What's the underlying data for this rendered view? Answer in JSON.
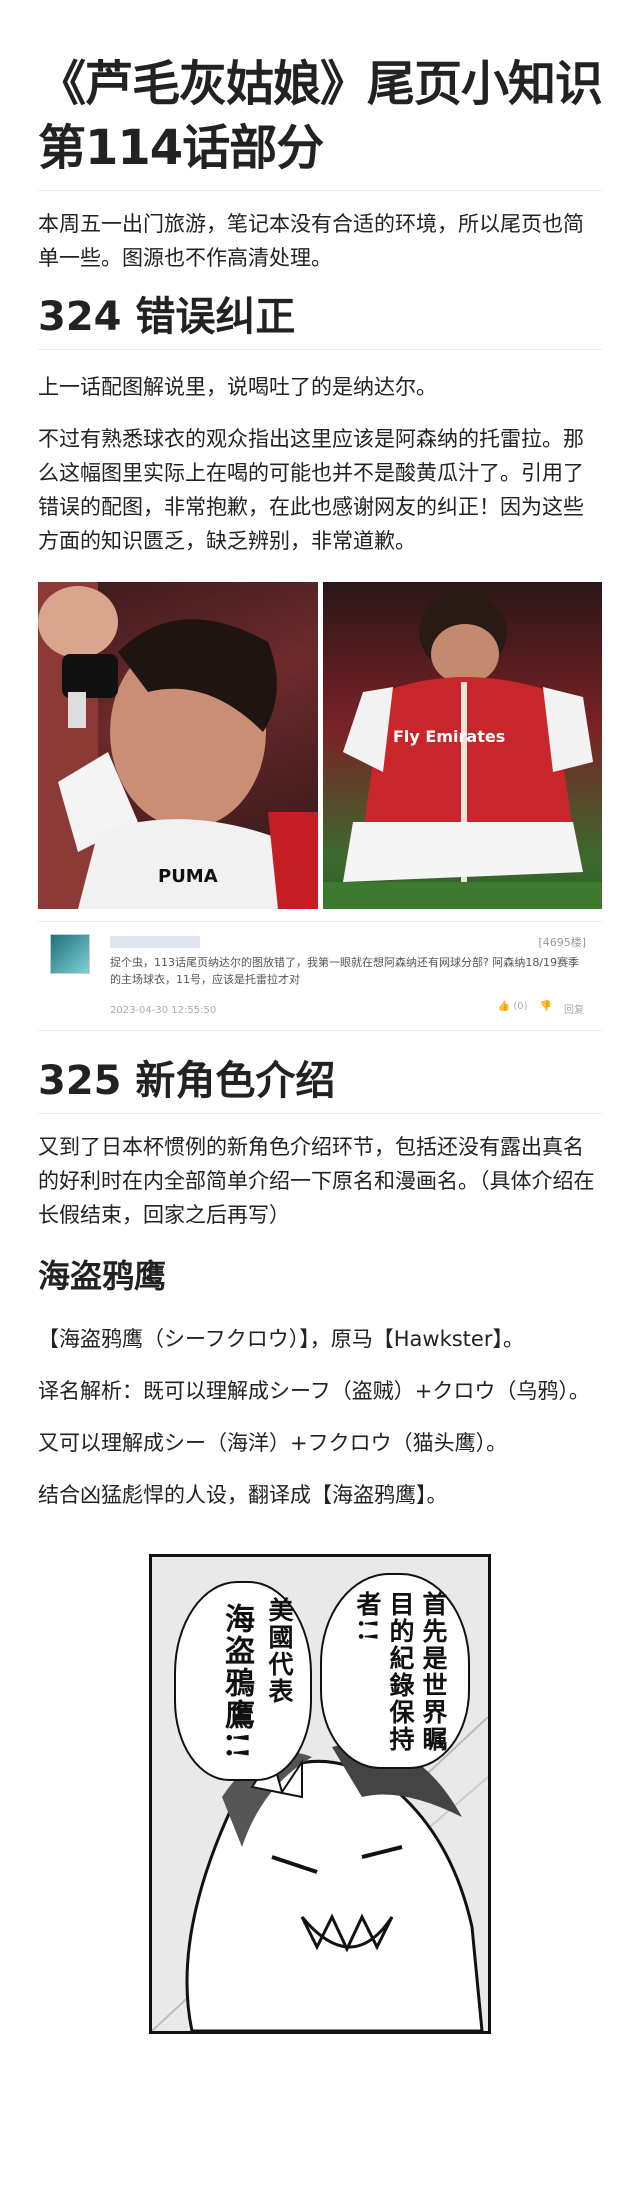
{
  "title": "《芦毛灰姑娘》尾页小知识 第114话部分",
  "intro": "本周五一出门旅游，笔记本没有合适的环境，所以尾页也简单一些。图源也不作高清处理。",
  "section324": {
    "heading": "324 错误纠正",
    "p1": "上一话配图解说里，说喝吐了的是纳达尔。",
    "p2": "不过有熟悉球衣的观众指出这里应该是阿森纳的托雷拉。那么这幅图里实际上在喝的可能也并不是酸黄瓜汁了。引用了错误的配图，非常抱歉，在此也感谢网友的纠正！因为这些方面的知识匮乏，缺乏辨别，非常道歉。"
  },
  "photos": {
    "left_jersey": "PUMA",
    "right_crest": "Fly Emirates"
  },
  "comment": {
    "likes": "[4695楼]",
    "text": "捉个虫，113话尾页纳达尔的图放错了，我第一眼就在想阿森纳还有网球分部? 阿森纳18/19赛季的主场球衣，11号，应该是托雷拉才对",
    "date": "2023-04-30 12:55:50",
    "reply": "回复",
    "count": "(0)"
  },
  "section325": {
    "heading": "325 新角色介绍",
    "p1": "又到了日本杯惯例的新角色介绍环节，包括还没有露出真名的好利时在内全部简单介绍一下原名和漫画名。（具体介绍在长假结束，回家之后再写）",
    "sub": "海盗鸦鹰",
    "p2": "【海盗鸦鹰（シーフクロウ）】，原马【Hawkster】。",
    "p3": "译名解析：既可以理解成シーフ（盗贼）+クロウ（乌鸦）。",
    "p4": "又可以理解成シー（海洋）+フクロウ（猫头鹰）。",
    "p5": "结合凶猛彪悍的人设，翻译成【海盗鸦鹰】。"
  },
  "manga": {
    "bubble_right": "首先是世界瞩目的紀錄保持者!!",
    "bubble_left_small": "美國代表",
    "bubble_left_big": "海盗鴉鷹!!"
  }
}
